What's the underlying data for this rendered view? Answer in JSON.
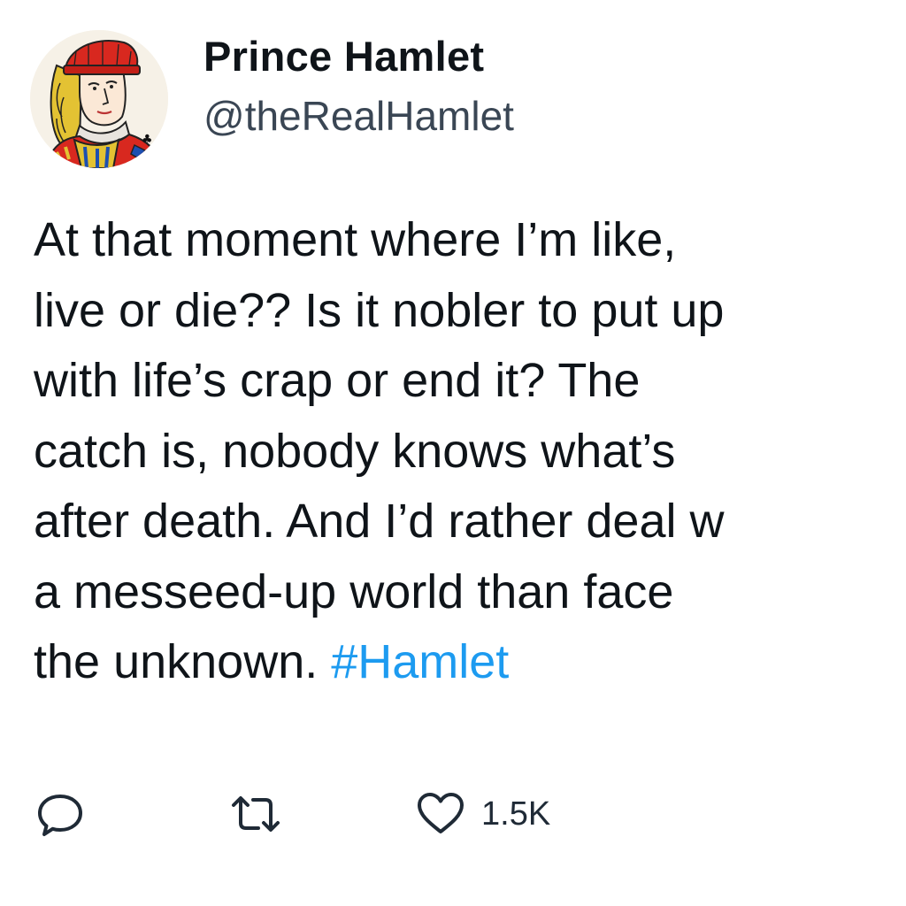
{
  "author": {
    "display_name": "Prince Hamlet",
    "handle": "@theRealHamlet",
    "avatar_icon": "jack-playing-card-portrait-icon"
  },
  "tweet": {
    "lines": [
      "At that moment where I’m like,",
      "live or die?? Is it nobler to put up",
      "with life’s crap or end it? The",
      "catch is, nobody knows what’s",
      "after death. And I’d rather deal w",
      "a messeed-up world than face",
      "the unknown. "
    ],
    "hashtag": "#Hamlet",
    "hashtag_color": "#1d9bf0"
  },
  "actions": {
    "reply_icon": "reply-icon",
    "retweet_icon": "retweet-icon",
    "like_icon": "heart-icon",
    "like_count": "1.5K"
  },
  "colors": {
    "text": "#0f1419",
    "handle": "#3a4654",
    "icons": "#1f2a36",
    "link": "#1d9bf0"
  }
}
